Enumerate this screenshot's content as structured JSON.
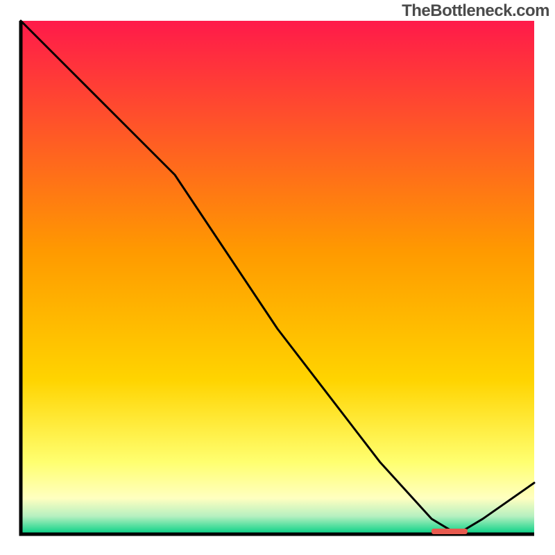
{
  "watermark": "TheBottleneck.com",
  "chart_data": {
    "type": "line",
    "title": "",
    "xlabel": "",
    "ylabel": "",
    "xlim": [
      0,
      100
    ],
    "ylim": [
      0,
      100
    ],
    "x": [
      0,
      10,
      20,
      30,
      40,
      50,
      60,
      70,
      80,
      85,
      90,
      100
    ],
    "values": [
      100,
      90,
      80,
      70,
      55,
      40,
      27,
      14,
      3,
      0,
      3,
      10
    ],
    "marker": {
      "x_start": 80,
      "x_end": 87,
      "y": 0
    },
    "colors": {
      "top": "#ff1a4a",
      "mid": "#ffd400",
      "pale": "#ffffa0",
      "green": "#00d084",
      "black": "#000000",
      "marker": "#e85a4f"
    }
  }
}
